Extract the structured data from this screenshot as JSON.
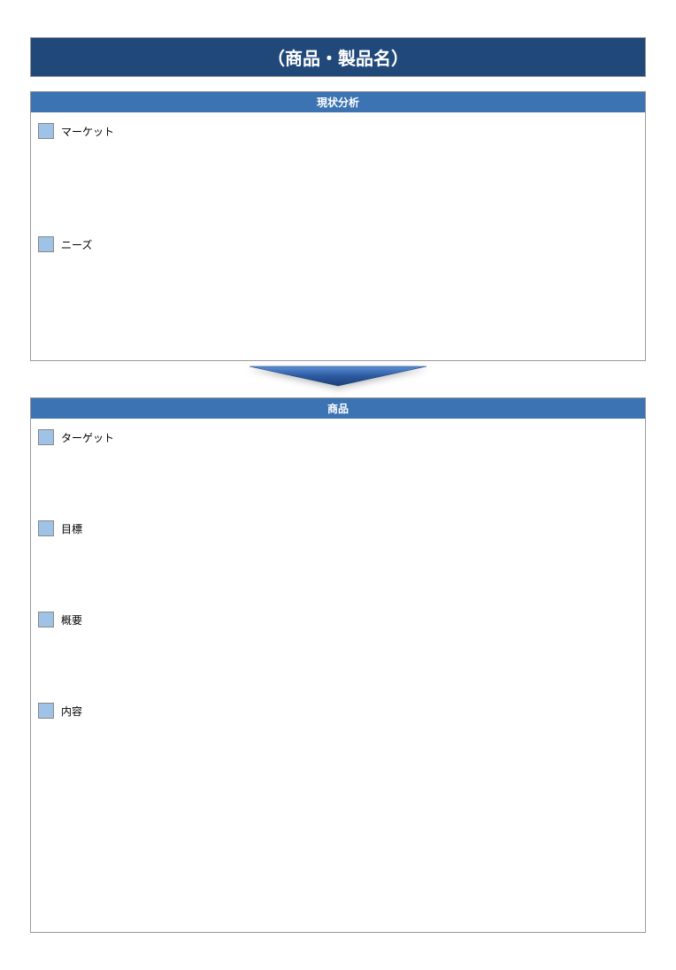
{
  "title": "（商品・製品名）",
  "sections": [
    {
      "header": "現状分析",
      "items": [
        {
          "label": "マーケット"
        },
        {
          "label": "ニーズ"
        }
      ]
    },
    {
      "header": "商品",
      "items": [
        {
          "label": "ターゲット"
        },
        {
          "label": "目標"
        },
        {
          "label": "概要"
        },
        {
          "label": "内容"
        }
      ]
    }
  ]
}
